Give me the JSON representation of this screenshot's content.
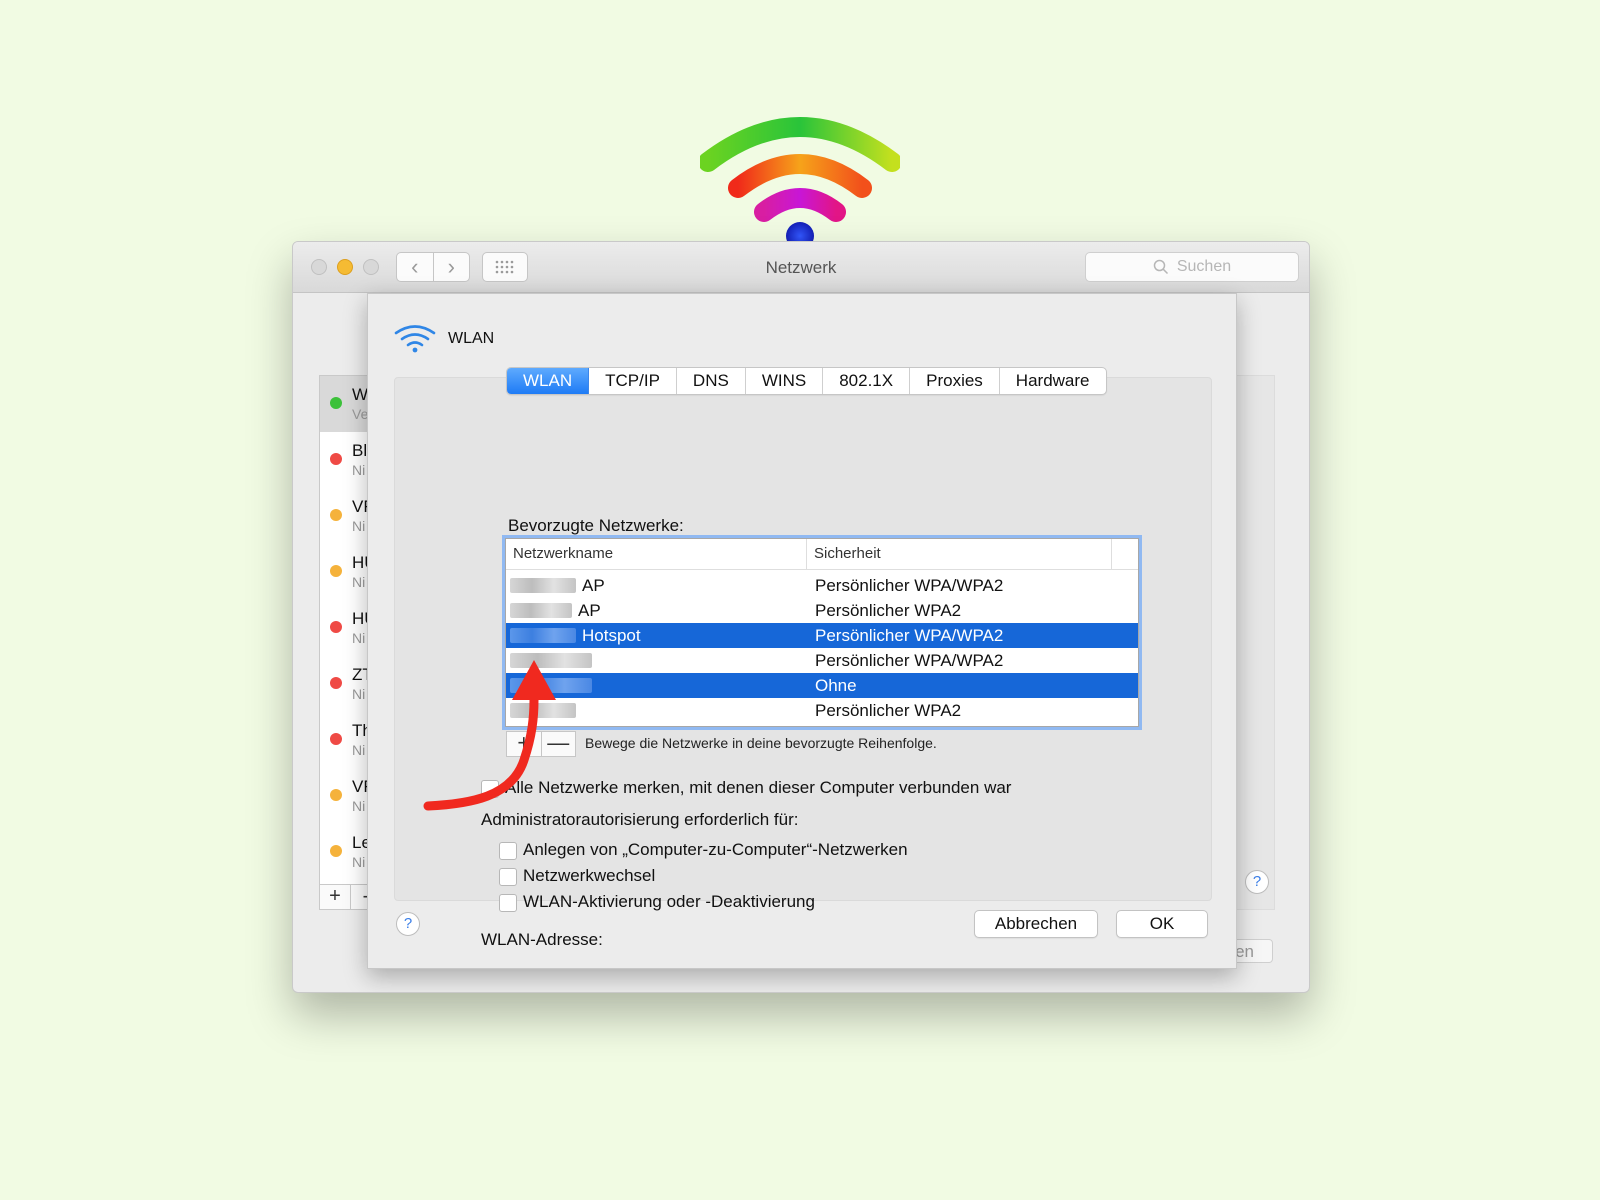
{
  "window": {
    "title": "Netzwerk",
    "search_placeholder": "Suchen"
  },
  "background": {
    "services": [
      {
        "name": "W",
        "status": "Ve",
        "color": "#3cc13a"
      },
      {
        "name": "Bl",
        "status": "Ni",
        "color": "#ef4a45"
      },
      {
        "name": "VF",
        "status": "Ni",
        "color": "#f5b23b"
      },
      {
        "name": "HU",
        "status": "Ni",
        "color": "#f5b23b"
      },
      {
        "name": "HU",
        "status": "Ni",
        "color": "#ef4a45"
      },
      {
        "name": "ZT",
        "status": "Ni",
        "color": "#ef4a45"
      },
      {
        "name": "Th",
        "status": "Ni",
        "color": "#ef4a45"
      },
      {
        "name": "VF",
        "status": "Ni",
        "color": "#f5b23b"
      },
      {
        "name": "Le",
        "status": "Ni",
        "color": "#f5b23b"
      }
    ],
    "plus_label": "+",
    "minus_label": "-",
    "partial_button": "den"
  },
  "sheet": {
    "title": "WLAN",
    "tabs": [
      "WLAN",
      "TCP/IP",
      "DNS",
      "WINS",
      "802.1X",
      "Proxies",
      "Hardware"
    ],
    "active_tab": "WLAN",
    "preferred_label": "Bevorzugte Netzwerke:",
    "table": {
      "columns": [
        "Netzwerkname",
        "Sicherheit"
      ],
      "rows": [
        {
          "name": "AP",
          "security": "Persönlicher WPA/WPA2",
          "selected": false
        },
        {
          "name": "AP",
          "security": "Persönlicher WPA2",
          "selected": false
        },
        {
          "name": "Hotspot",
          "security": "Persönlicher WPA/WPA2",
          "selected": true
        },
        {
          "name": "",
          "security": "Persönlicher WPA/WPA2",
          "selected": false
        },
        {
          "name": "",
          "security": "Ohne",
          "selected": true
        },
        {
          "name": "",
          "security": "Persönlicher WPA2",
          "selected": false
        }
      ]
    },
    "plus": "+",
    "minus": "—",
    "hint": "Bewege die Netzwerke in deine bevorzugte Reihenfolge.",
    "remember_checkbox": "Alle Netzwerke merken, mit denen dieser Computer verbunden war",
    "admin_label": "Administratorautorisierung erforderlich für:",
    "admin_options": [
      "Anlegen von „Computer-zu-Computer“-Netzwerken",
      "Netzwerkwechsel",
      "WLAN-Aktivierung oder -Deaktivierung"
    ],
    "address_label": "WLAN-Adresse:",
    "help": "?",
    "cancel": "Abbrechen",
    "ok": "OK"
  },
  "colors": {
    "accent": "#1e7bf5",
    "selection": "#1667d8",
    "annotation_arrow": "#f0291f",
    "page_background": "#f1fbe3"
  }
}
